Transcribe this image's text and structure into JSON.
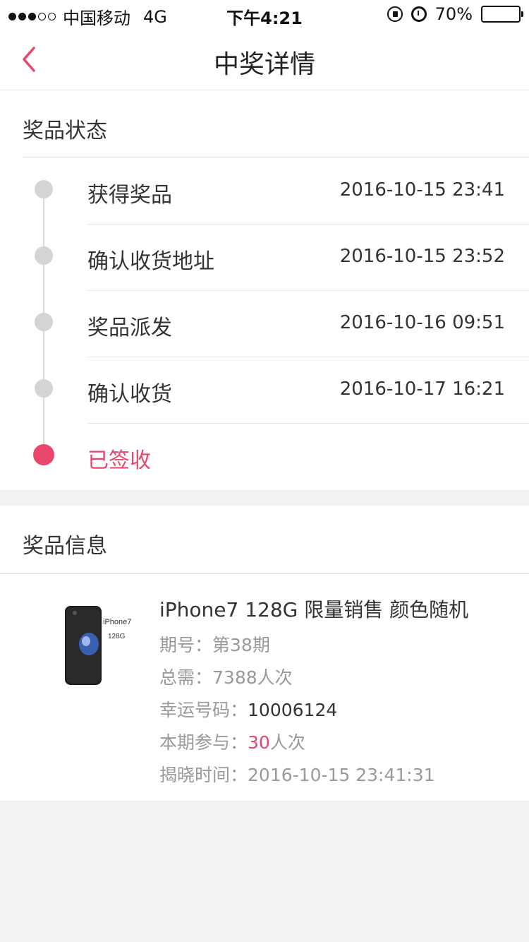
{
  "status_bar": {
    "carrier": "中国移动",
    "network": "4G",
    "time": "下午4:21",
    "battery": "70%",
    "battery_level": 0.7
  },
  "nav": {
    "title": "中奖详情",
    "back_icon": "chevron-left-icon"
  },
  "prize_status": {
    "title": "奖品状态",
    "steps": [
      {
        "label": "获得奖品",
        "time": "2016-10-15 23:41"
      },
      {
        "label": "确认收货地址",
        "time": "2016-10-15 23:52"
      },
      {
        "label": "奖品派发",
        "time": "2016-10-16 09:51"
      },
      {
        "label": "确认收货",
        "time": "2016-10-17 16:21"
      },
      {
        "label": "已签收",
        "time": ""
      }
    ]
  },
  "prize_info": {
    "title": "奖品信息",
    "image_text_1": "iPhone7",
    "image_text_2": "128G",
    "name": "iPhone7 128G 限量销售 颜色随机",
    "issue_label": "期号：",
    "issue_value": "第38期",
    "total_label": "总需：",
    "total_value": "7388人次",
    "lucky_label": "幸运号码：",
    "lucky_value": "10006124",
    "joined_label": "本期参与：",
    "joined_count": "30",
    "joined_unit": "人次",
    "reveal_label": "揭晓时间：",
    "reveal_value": "2016-10-15 23:41:31"
  },
  "colors": {
    "accent": "#e8466a",
    "inactive_dot": "#d4d4d4"
  }
}
